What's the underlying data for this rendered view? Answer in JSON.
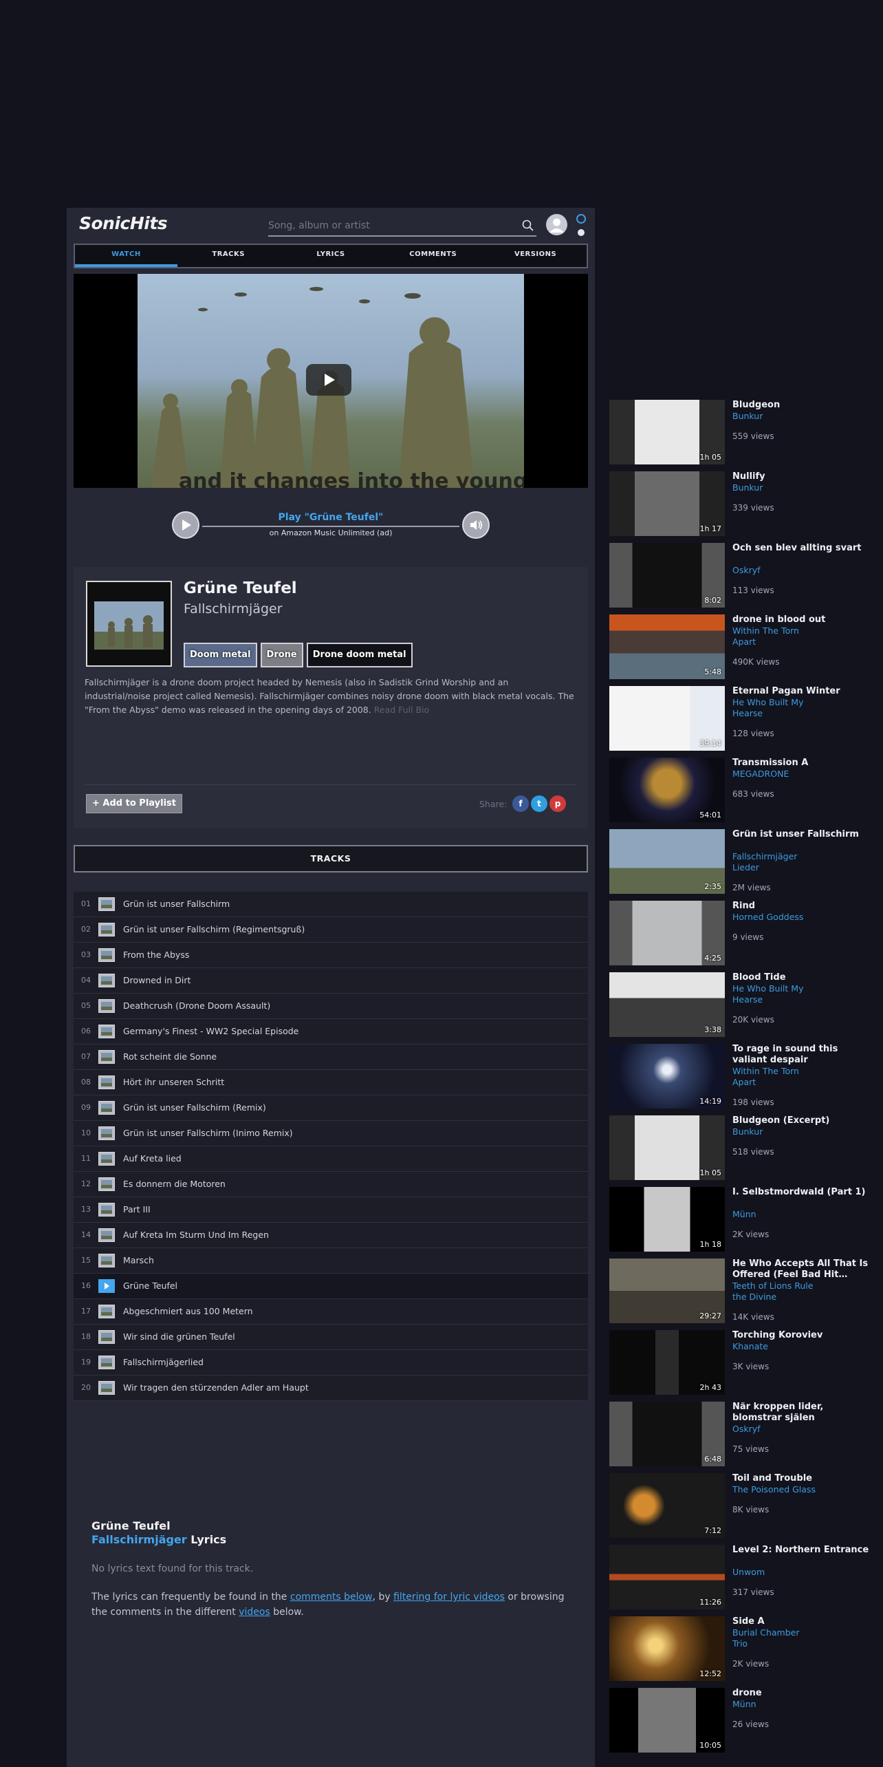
{
  "app": {
    "logo": "SonicHits"
  },
  "search": {
    "placeholder": "Song, album or artist"
  },
  "tabs": [
    "WATCH",
    "TRACKS",
    "LYRICS",
    "COMMENTS",
    "VERSIONS"
  ],
  "video": {
    "caption": "and it changes into the young heart"
  },
  "player": {
    "title": "Play \"Grüne Teufel\"",
    "subtitle": "on Amazon Music Unlimited (ad)"
  },
  "album": {
    "title": "Grüne Teufel",
    "artist": "Fallschirmjäger",
    "genres": [
      "Doom metal",
      "Drone",
      "Drone doom metal"
    ],
    "bio": "Fallschirmjäger is a drone doom project headed by Nemesis (also in Sadistik Grind Worship and an industrial/noise project called Nemesis). Fallschirmjäger combines noisy drone doom with black metal vocals. The \"From the Abyss\" demo was released in the opening days of 2008.",
    "read_more": "Read Full Bio",
    "add_playlist": "+ Add to Playlist",
    "share_label": "Share:"
  },
  "tracks_header": "TRACKS",
  "tracks": [
    {
      "num": "01",
      "name": "Grün ist unser Fallschirm"
    },
    {
      "num": "02",
      "name": "Grün ist unser Fallschirm (Regimentsgruß)"
    },
    {
      "num": "03",
      "name": "From the Abyss"
    },
    {
      "num": "04",
      "name": "Drowned in Dirt"
    },
    {
      "num": "05",
      "name": "Deathcrush (Drone Doom Assault)"
    },
    {
      "num": "06",
      "name": "Germany's Finest - WW2 Special Episode"
    },
    {
      "num": "07",
      "name": "Rot scheint die Sonne"
    },
    {
      "num": "08",
      "name": "Hört ihr unseren Schritt"
    },
    {
      "num": "09",
      "name": "Grün ist unser Fallschirm (Remix)"
    },
    {
      "num": "10",
      "name": "Grün ist unser Fallschirm (Inimo Remix)"
    },
    {
      "num": "11",
      "name": "Auf Kreta lied"
    },
    {
      "num": "12",
      "name": "Es donnern die Motoren"
    },
    {
      "num": "13",
      "name": "Part III"
    },
    {
      "num": "14",
      "name": "Auf Kreta Im Sturm Und Im Regen"
    },
    {
      "num": "15",
      "name": "Marsch"
    },
    {
      "num": "16",
      "name": "Grüne Teufel"
    },
    {
      "num": "17",
      "name": "Abgeschmiert aus 100 Metern"
    },
    {
      "num": "18",
      "name": "Wir sind die grünen Teufel"
    },
    {
      "num": "19",
      "name": "Fallschirmjägerlied"
    },
    {
      "num": "20",
      "name": "Wir tragen den stürzenden Adler am Haupt"
    }
  ],
  "active_track": "16",
  "lyrics": {
    "title": "Grüne Teufel",
    "artist": "Fallschirmjäger",
    "suffix": " Lyrics",
    "empty": "No lyrics text found for this track.",
    "help_1": "The lyrics can frequently be found in the ",
    "help_link_1": "comments below",
    "help_2": ", by ",
    "help_link_2": "filtering for lyric videos",
    "help_3": " or browsing the comments in the different ",
    "help_link_3": "videos",
    "help_4": " below."
  },
  "related": [
    {
      "title": "Bludgeon",
      "artists": [
        "Bunkur"
      ],
      "views": "559 views",
      "duration": "1h 05"
    },
    {
      "title": "Nullify",
      "artists": [
        "Bunkur"
      ],
      "views": "339 views",
      "duration": "1h 17"
    },
    {
      "title": "Och sen blev allting svart",
      "artists": [
        "Oskryf"
      ],
      "views": "113 views",
      "duration": "8:02"
    },
    {
      "title": "drone in blood out",
      "artists": [
        "Within The Torn",
        "Apart"
      ],
      "views": "490K views",
      "duration": "5:48"
    },
    {
      "title": "Eternal Pagan Winter",
      "artists": [
        "He Who Built My",
        "Hearse"
      ],
      "views": "128 views",
      "duration": "39:14"
    },
    {
      "title": "Transmission A",
      "artists": [
        "MEGADRONE"
      ],
      "views": "683 views",
      "duration": "54:01"
    },
    {
      "title": "Grün ist unser Fallschirm",
      "artists": [
        "Fallschirmjäger",
        "Lieder"
      ],
      "views": "2M views",
      "duration": "2:35"
    },
    {
      "title": "Rind",
      "artists": [
        "Horned Goddess"
      ],
      "views": "9 views",
      "duration": "4:25"
    },
    {
      "title": "Blood Tide",
      "artists": [
        "He Who Built My",
        "Hearse"
      ],
      "views": "20K views",
      "duration": "3:38"
    },
    {
      "title": "To rage in sound this valiant despair",
      "artists": [
        "Within The Torn",
        "Apart"
      ],
      "views": "198 views",
      "duration": "14:19"
    },
    {
      "title": "Bludgeon (Excerpt)",
      "artists": [
        "Bunkur"
      ],
      "views": "518 views",
      "duration": "1h 05"
    },
    {
      "title": "I. Selbstmordwald (Part 1)",
      "artists": [
        "Münn"
      ],
      "views": "2K views",
      "duration": "1h 18"
    },
    {
      "title": "He Who Accepts All That Is Offered (Feel Bad Hit…",
      "artists": [
        "Teeth of Lions Rule",
        "the Divine"
      ],
      "views": "14K views",
      "duration": "29:27"
    },
    {
      "title": "Torching Koroviev",
      "artists": [
        "Khanate"
      ],
      "views": "3K views",
      "duration": "2h 43"
    },
    {
      "title": "När kroppen lider, blomstrar själen",
      "artists": [
        "Oskryf"
      ],
      "views": "75 views",
      "duration": "6:48"
    },
    {
      "title": "Toil and Trouble",
      "artists": [
        "The Poisoned Glass"
      ],
      "views": "8K views",
      "duration": "7:12"
    },
    {
      "title": "Level 2: Northern Entrance",
      "artists": [
        "Unwom"
      ],
      "views": "317 views",
      "duration": "11:26"
    },
    {
      "title": "Side A",
      "artists": [
        "Burial Chamber",
        "Trio"
      ],
      "views": "2K views",
      "duration": "12:52"
    },
    {
      "title": "drone",
      "artists": [
        "Münn"
      ],
      "views": "26 views",
      "duration": "10:05"
    }
  ],
  "colors": {
    "accent": "#3d9be0",
    "background": "#12131d",
    "panel": "#262835"
  },
  "icons": {
    "search": "search-icon",
    "play": "play-icon",
    "volume": "volume-icon",
    "facebook": "facebook-icon",
    "twitter": "twitter-icon",
    "pinterest": "pinterest-icon"
  }
}
